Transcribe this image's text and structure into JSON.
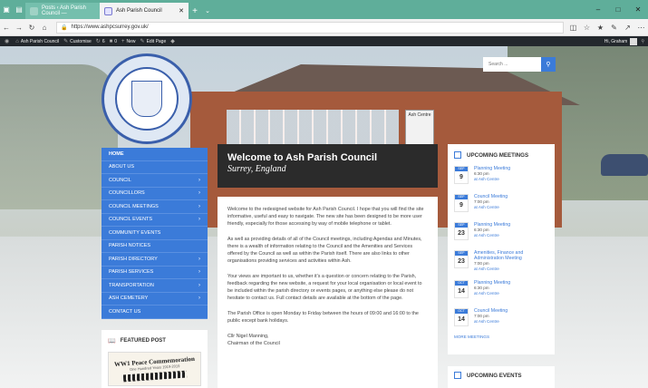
{
  "browser": {
    "tabs": [
      {
        "title": "Posts ‹ Ash Parish Council —"
      },
      {
        "title": "Ash Parish Council"
      }
    ],
    "url": "https://www.ashpcsurrey.gov.uk/"
  },
  "admin_bar": {
    "site": "Ash Parish Council",
    "customise": "Customise",
    "updates": "6",
    "comments": "0",
    "new": "New",
    "edit": "Edit Page",
    "greeting": "Hi, Graham"
  },
  "logo": {
    "text": "ASH PARISH COUNCIL"
  },
  "hero": {
    "sign": "Ash Centre"
  },
  "search": {
    "placeholder": "Search ..."
  },
  "nav": {
    "items": [
      {
        "label": "HOME"
      },
      {
        "label": "ABOUT US"
      },
      {
        "label": "COUNCIL"
      },
      {
        "label": "COUNCILLORS"
      },
      {
        "label": "COUNCIL MEETINGS"
      },
      {
        "label": "COUNCIL EVENTS"
      },
      {
        "label": "COMMUNITY EVENTS"
      },
      {
        "label": "PARISH NOTICES"
      },
      {
        "label": "PARISH DIRECTORY"
      },
      {
        "label": "PARISH SERVICES"
      },
      {
        "label": "TRANSPORTATION"
      },
      {
        "label": "ASH CEMETERY"
      },
      {
        "label": "CONTACT US"
      }
    ]
  },
  "featured": {
    "heading": "FEATURED POST",
    "image_title": "WW1 Peace Commemoration",
    "image_subtitle": "One Hundred Years 1919-2019"
  },
  "welcome": {
    "title": "Welcome to Ash Parish Council",
    "subtitle": "Surrey, England"
  },
  "content": {
    "paragraphs": [
      "Welcome to the redesigned website for Ash Parish Council. I hope that you will find the site informative, useful and easy to navigate. The new site has been designed to be more user friendly, especially for those accessing by way of mobile telephone or tablet.",
      "As well as providing details of all of the Council meetings, including Agendas and Minutes, there is a wealth of information relating to the Council and the Amenities and Services offered by the Council as well as within the Parish itself. There are also links to other organisations providing services and activities within Ash.",
      "Your views are important to us, whether it's a question or concern relating to the Parish, feedback regarding the new website, a request for your local organisation or local event to be included within the parish directory or events pages, or anything else please do not hesitate to contact us. Full contact details are available at the bottom of the page.",
      "The Parish Office is open Monday to Friday between the hours of 09:00 and 16:00 to the public except bank holidays.",
      "Cllr Nigel Manning,\nChairman of the Council"
    ]
  },
  "meetings": {
    "heading": "UPCOMING MEETINGS",
    "events": [
      {
        "month": "SEP",
        "day": "9",
        "title": "Planning Meeting",
        "time": "6:30 pm",
        "location": "at Ash Centre"
      },
      {
        "month": "SEP",
        "day": "9",
        "title": "Council Meeting",
        "time": "7:00 pm",
        "location": "at Ash Centre"
      },
      {
        "month": "SEP",
        "day": "23",
        "title": "Planning Meeting",
        "time": "6:30 pm",
        "location": "at Ash Centre"
      },
      {
        "month": "SEP",
        "day": "23",
        "title": "Amenities, Finance and Administration Meeting",
        "time": "7:00 pm",
        "location": "at Ash Centre"
      },
      {
        "month": "OCT",
        "day": "14",
        "title": "Planning Meeting",
        "time": "6:30 pm",
        "location": "at Ash Centre"
      },
      {
        "month": "OCT",
        "day": "14",
        "title": "Council Meeting",
        "time": "7:00 pm",
        "location": "at Ash Centre"
      }
    ],
    "more": "MORE MEETINGS"
  },
  "upcoming_events": {
    "heading": "UPCOMING EVENTS"
  },
  "colors": {
    "accent": "#3b7bd9",
    "tabbar": "#5fae9a",
    "adminbar": "#23282d"
  }
}
